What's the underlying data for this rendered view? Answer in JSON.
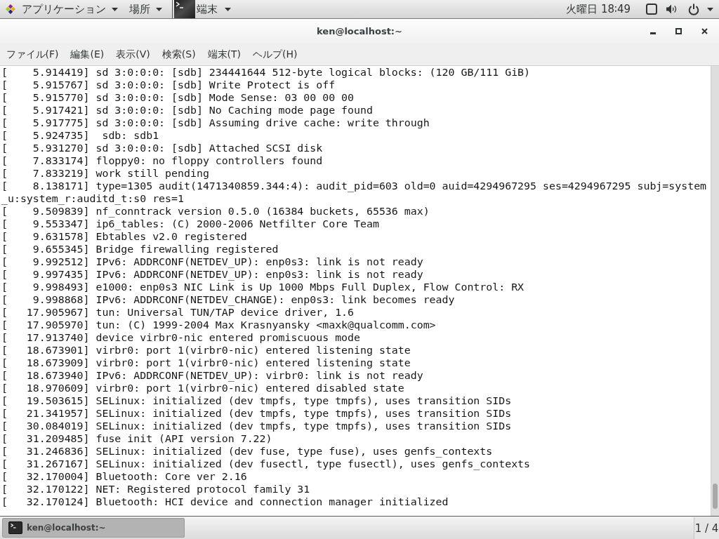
{
  "top_bar": {
    "applications_menu": "アプリケーション",
    "places_menu": "場所",
    "app_menu": "端末",
    "clock": "火曜日 18∶49"
  },
  "window": {
    "title": "ken@localhost:~"
  },
  "menu_bar": [
    "ファイル(F)",
    "編集(E)",
    "表示(V)",
    "検索(S)",
    "端末(T)",
    "ヘルプ(H)"
  ],
  "terminal": {
    "lines": [
      "[    5.914419] sd 3:0:0:0: [sdb] 234441644 512-byte logical blocks: (120 GB/111 GiB)",
      "[    5.915767] sd 3:0:0:0: [sdb] Write Protect is off",
      "[    5.915770] sd 3:0:0:0: [sdb] Mode Sense: 03 00 00 00",
      "[    5.917421] sd 3:0:0:0: [sdb] No Caching mode page found",
      "[    5.917775] sd 3:0:0:0: [sdb] Assuming drive cache: write through",
      "[    5.924735]  sdb: sdb1",
      "[    5.931270] sd 3:0:0:0: [sdb] Attached SCSI disk",
      "[    7.833174] floppy0: no floppy controllers found",
      "[    7.833219] work still pending",
      "[    8.138171] type=1305 audit(1471340859.344:4): audit_pid=603 old=0 auid=4294967295 ses=4294967295 subj=system",
      "_u:system_r:auditd_t:s0 res=1",
      "[    9.509839] nf_conntrack version 0.5.0 (16384 buckets, 65536 max)",
      "[    9.553347] ip6_tables: (C) 2000-2006 Netfilter Core Team",
      "[    9.631578] Ebtables v2.0 registered",
      "[    9.655345] Bridge firewalling registered",
      "[    9.992512] IPv6: ADDRCONF(NETDEV_UP): enp0s3: link is not ready",
      "[    9.997435] IPv6: ADDRCONF(NETDEV_UP): enp0s3: link is not ready",
      "[    9.998493] e1000: enp0s3 NIC Link is Up 1000 Mbps Full Duplex, Flow Control: RX",
      "[    9.998868] IPv6: ADDRCONF(NETDEV_CHANGE): enp0s3: link becomes ready",
      "[   17.905967] tun: Universal TUN/TAP device driver, 1.6",
      "[   17.905970] tun: (C) 1999-2004 Max Krasnyansky <maxk@qualcomm.com>",
      "[   17.913740] device virbr0-nic entered promiscuous mode",
      "[   18.673901] virbr0: port 1(virbr0-nic) entered listening state",
      "[   18.673909] virbr0: port 1(virbr0-nic) entered listening state",
      "[   18.673940] IPv6: ADDRCONF(NETDEV_UP): virbr0: link is not ready",
      "[   18.970609] virbr0: port 1(virbr0-nic) entered disabled state",
      "[   19.503615] SELinux: initialized (dev tmpfs, type tmpfs), uses transition SIDs",
      "[   21.341957] SELinux: initialized (dev tmpfs, type tmpfs), uses transition SIDs",
      "[   30.084019] SELinux: initialized (dev tmpfs, type tmpfs), uses transition SIDs",
      "[   31.209485] fuse init (API version 7.22)",
      "[   31.246836] SELinux: initialized (dev fuse, type fuse), uses genfs_contexts",
      "[   31.267167] SELinux: initialized (dev fusectl, type fusectl), uses genfs_contexts",
      "[   32.170004] Bluetooth: Core ver 2.16",
      "[   32.170122] NET: Registered protocol family 31",
      "[   32.170124] Bluetooth: HCI device and connection manager initialized"
    ]
  },
  "taskbar": {
    "tasks": [
      {
        "label": "ken@localhost:~",
        "selected": true
      }
    ],
    "workspace": "1 / 4"
  }
}
